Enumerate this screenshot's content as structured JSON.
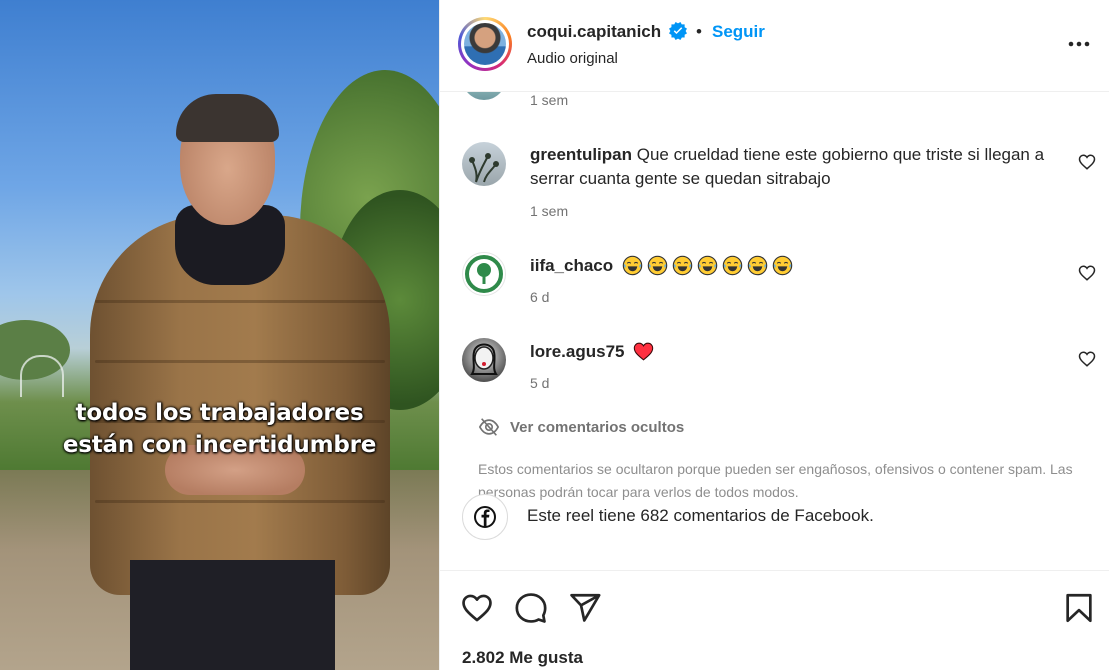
{
  "video": {
    "caption_line1": "todos los trabajadores",
    "caption_line2": "están con incertidumbre"
  },
  "header": {
    "username": "coqui.capitanich",
    "separator": "•",
    "follow_label": "Seguir",
    "subtitle": "Audio original"
  },
  "previous_comment": {
    "time": "1 sem"
  },
  "comments": [
    {
      "user": "greentulipan",
      "text": "Que crueldad tiene este gobierno que triste si llegan a serrar cuanta gente se quedan sitrabajo",
      "time": "1 sem"
    },
    {
      "user": "iifa_chaco",
      "text": "",
      "emojis": [
        "face-with-tears-of-joy",
        "face-with-tears-of-joy",
        "face-with-tears-of-joy",
        "face-with-tears-of-joy",
        "face-with-tears-of-joy",
        "face-with-tears-of-joy",
        "face-with-tears-of-joy"
      ],
      "time": "6 d"
    },
    {
      "user": "lore.agus75",
      "text": "",
      "emojis": [
        "red-heart"
      ],
      "time": "5 d"
    }
  ],
  "hidden_comments": {
    "label": "Ver comentarios ocultos",
    "description": "Estos comentarios se ocultaron porque pueden ser engañosos, ofensivos o contener spam. Las personas podrán tocar para verlos de todos modos."
  },
  "facebook": {
    "text": "Este reel tiene 682 comentarios de Facebook."
  },
  "actions": {
    "icons": [
      "heart-icon",
      "comment-icon",
      "share-icon",
      "bookmark-icon"
    ],
    "likes": "2.802 Me gusta"
  },
  "colors": {
    "link": "#0095f6",
    "text": "#262626",
    "muted": "#737373",
    "heart": "#ff3040"
  }
}
